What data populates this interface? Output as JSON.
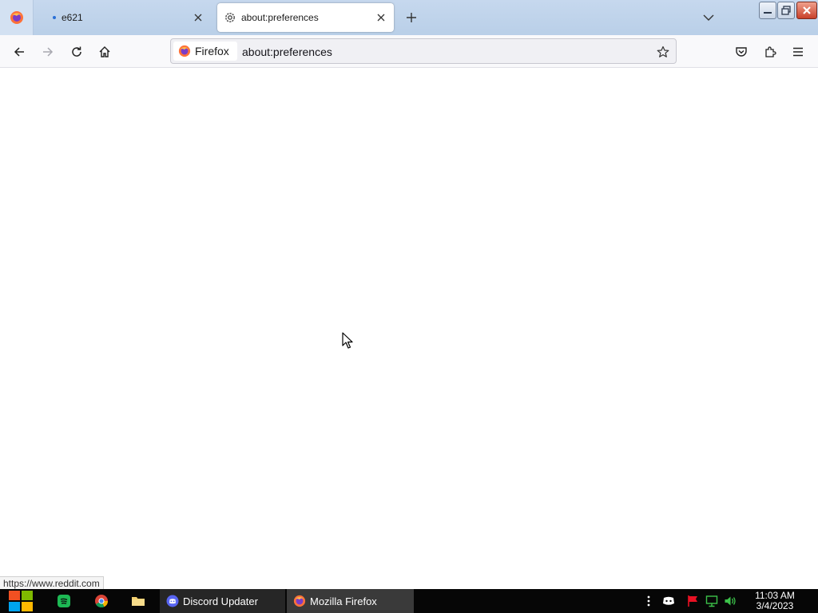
{
  "browser": {
    "tabs": [
      {
        "title": "e621",
        "active": false
      },
      {
        "title": "about:preferences",
        "active": true
      }
    ],
    "urlbar": {
      "identity_label": "Firefox",
      "url": "about:preferences"
    },
    "status_link": "https://www.reddit.com"
  },
  "taskbar": {
    "tasks": [
      {
        "label": "Discord Updater"
      },
      {
        "label": "Mozilla Firefox"
      }
    ],
    "clock": {
      "time": "11:03 AM",
      "date": "3/4/2023"
    }
  },
  "colors": {
    "tabstrip": "#c6d8ee",
    "toolbar": "#f9f9fb",
    "taskbar": "#060606",
    "firefox_orange": "#ff7139",
    "spotify_green": "#1db954",
    "discord_blurple": "#5865f2"
  },
  "icons": [
    "firefox-icon",
    "gear-icon",
    "close-icon",
    "plus-icon",
    "chevron-down-icon",
    "back-icon",
    "forward-icon",
    "reload-icon",
    "home-icon",
    "star-icon",
    "pocket-icon",
    "extensions-icon",
    "menu-icon",
    "windows-start-icon",
    "spotify-icon",
    "chrome-icon",
    "folder-icon",
    "discord-icon",
    "overflow-icon",
    "flag-icon",
    "network-icon",
    "volume-icon"
  ]
}
